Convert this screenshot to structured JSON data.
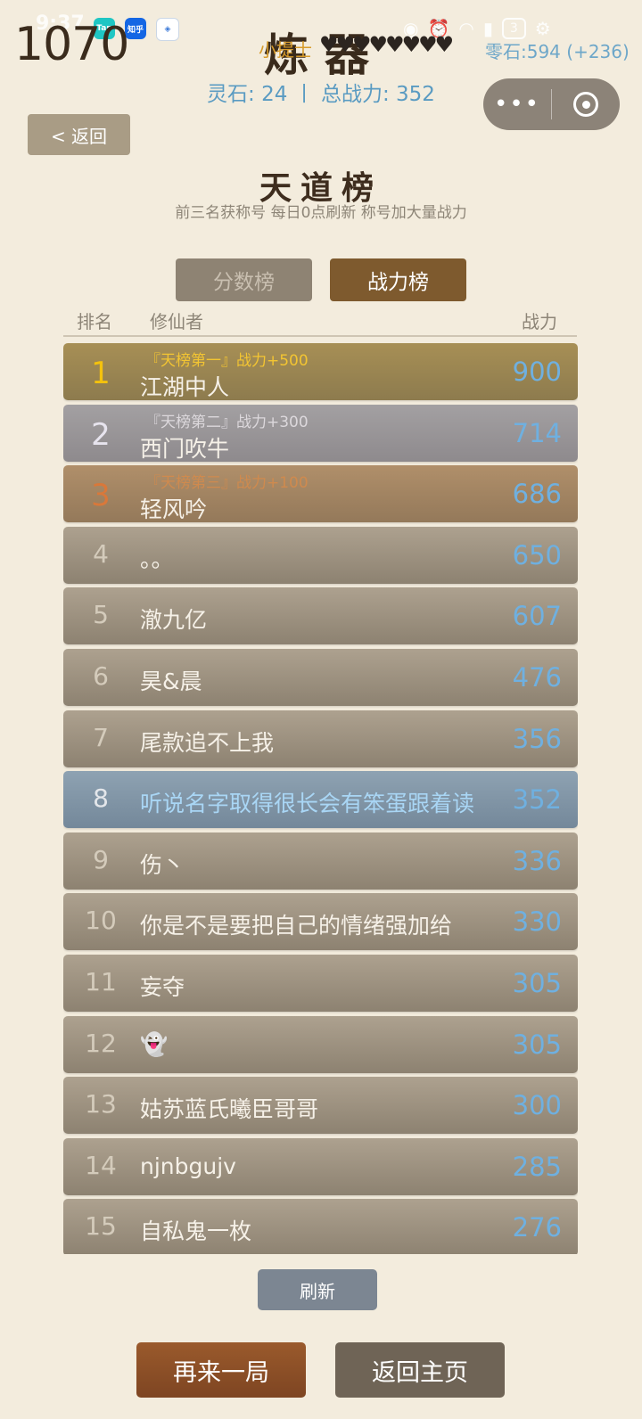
{
  "status_bar": {
    "time": "9:37",
    "apps": [
      "Tap",
      "知乎"
    ],
    "battery": "3"
  },
  "overlay": {
    "big_number": "1070",
    "tip_label": "小提士",
    "hearts": "♥♥♥♥♥♥♥♥",
    "zero_stone": "零石:594 (+236)"
  },
  "header": {
    "title": "炼器",
    "stats": "灵石: 24 丨 总战力: 352"
  },
  "back_label": "< 返回",
  "leaderboard": {
    "title": "天道榜",
    "subtitle": "前三名获称号 每日0点刷新 称号加大量战力",
    "tabs": [
      {
        "label": "分数榜",
        "active": false
      },
      {
        "label": "战力榜",
        "active": true
      }
    ],
    "columns": {
      "rank": "排名",
      "player": "修仙者",
      "power": "战力"
    },
    "rows": [
      {
        "rank": "1",
        "title": "『天榜第一』战力+500",
        "name": "江湖中人",
        "power": "900"
      },
      {
        "rank": "2",
        "title": "『天榜第二』战力+300",
        "name": "西门吹牛",
        "power": "714"
      },
      {
        "rank": "3",
        "title": "『天榜第三』战力+100",
        "name": "轻风吟",
        "power": "686"
      },
      {
        "rank": "4",
        "name": "。。",
        "power": "650"
      },
      {
        "rank": "5",
        "name": "澈九亿",
        "power": "607"
      },
      {
        "rank": "6",
        "name": "昊&晨",
        "power": "476"
      },
      {
        "rank": "7",
        "name": "尾款追不上我",
        "power": "356"
      },
      {
        "rank": "8",
        "name": "听说名字取得很长会有笨蛋跟着读",
        "power": "352",
        "self": true
      },
      {
        "rank": "9",
        "name": "伤丶",
        "power": "336"
      },
      {
        "rank": "10",
        "name": "你是不是要把自己的情绪强加给",
        "power": "330"
      },
      {
        "rank": "11",
        "name": "妄夺",
        "power": "305"
      },
      {
        "rank": "12",
        "name": "👻",
        "power": "305"
      },
      {
        "rank": "13",
        "name": "姑苏蓝氏曦臣哥哥",
        "power": "300"
      },
      {
        "rank": "14",
        "name": "njnbgujv",
        "power": "285"
      },
      {
        "rank": "15",
        "name": "自私鬼一枚",
        "power": "276"
      }
    ]
  },
  "refresh_label": "刷新",
  "buttons": {
    "again": "再来一局",
    "home": "返回主页"
  }
}
